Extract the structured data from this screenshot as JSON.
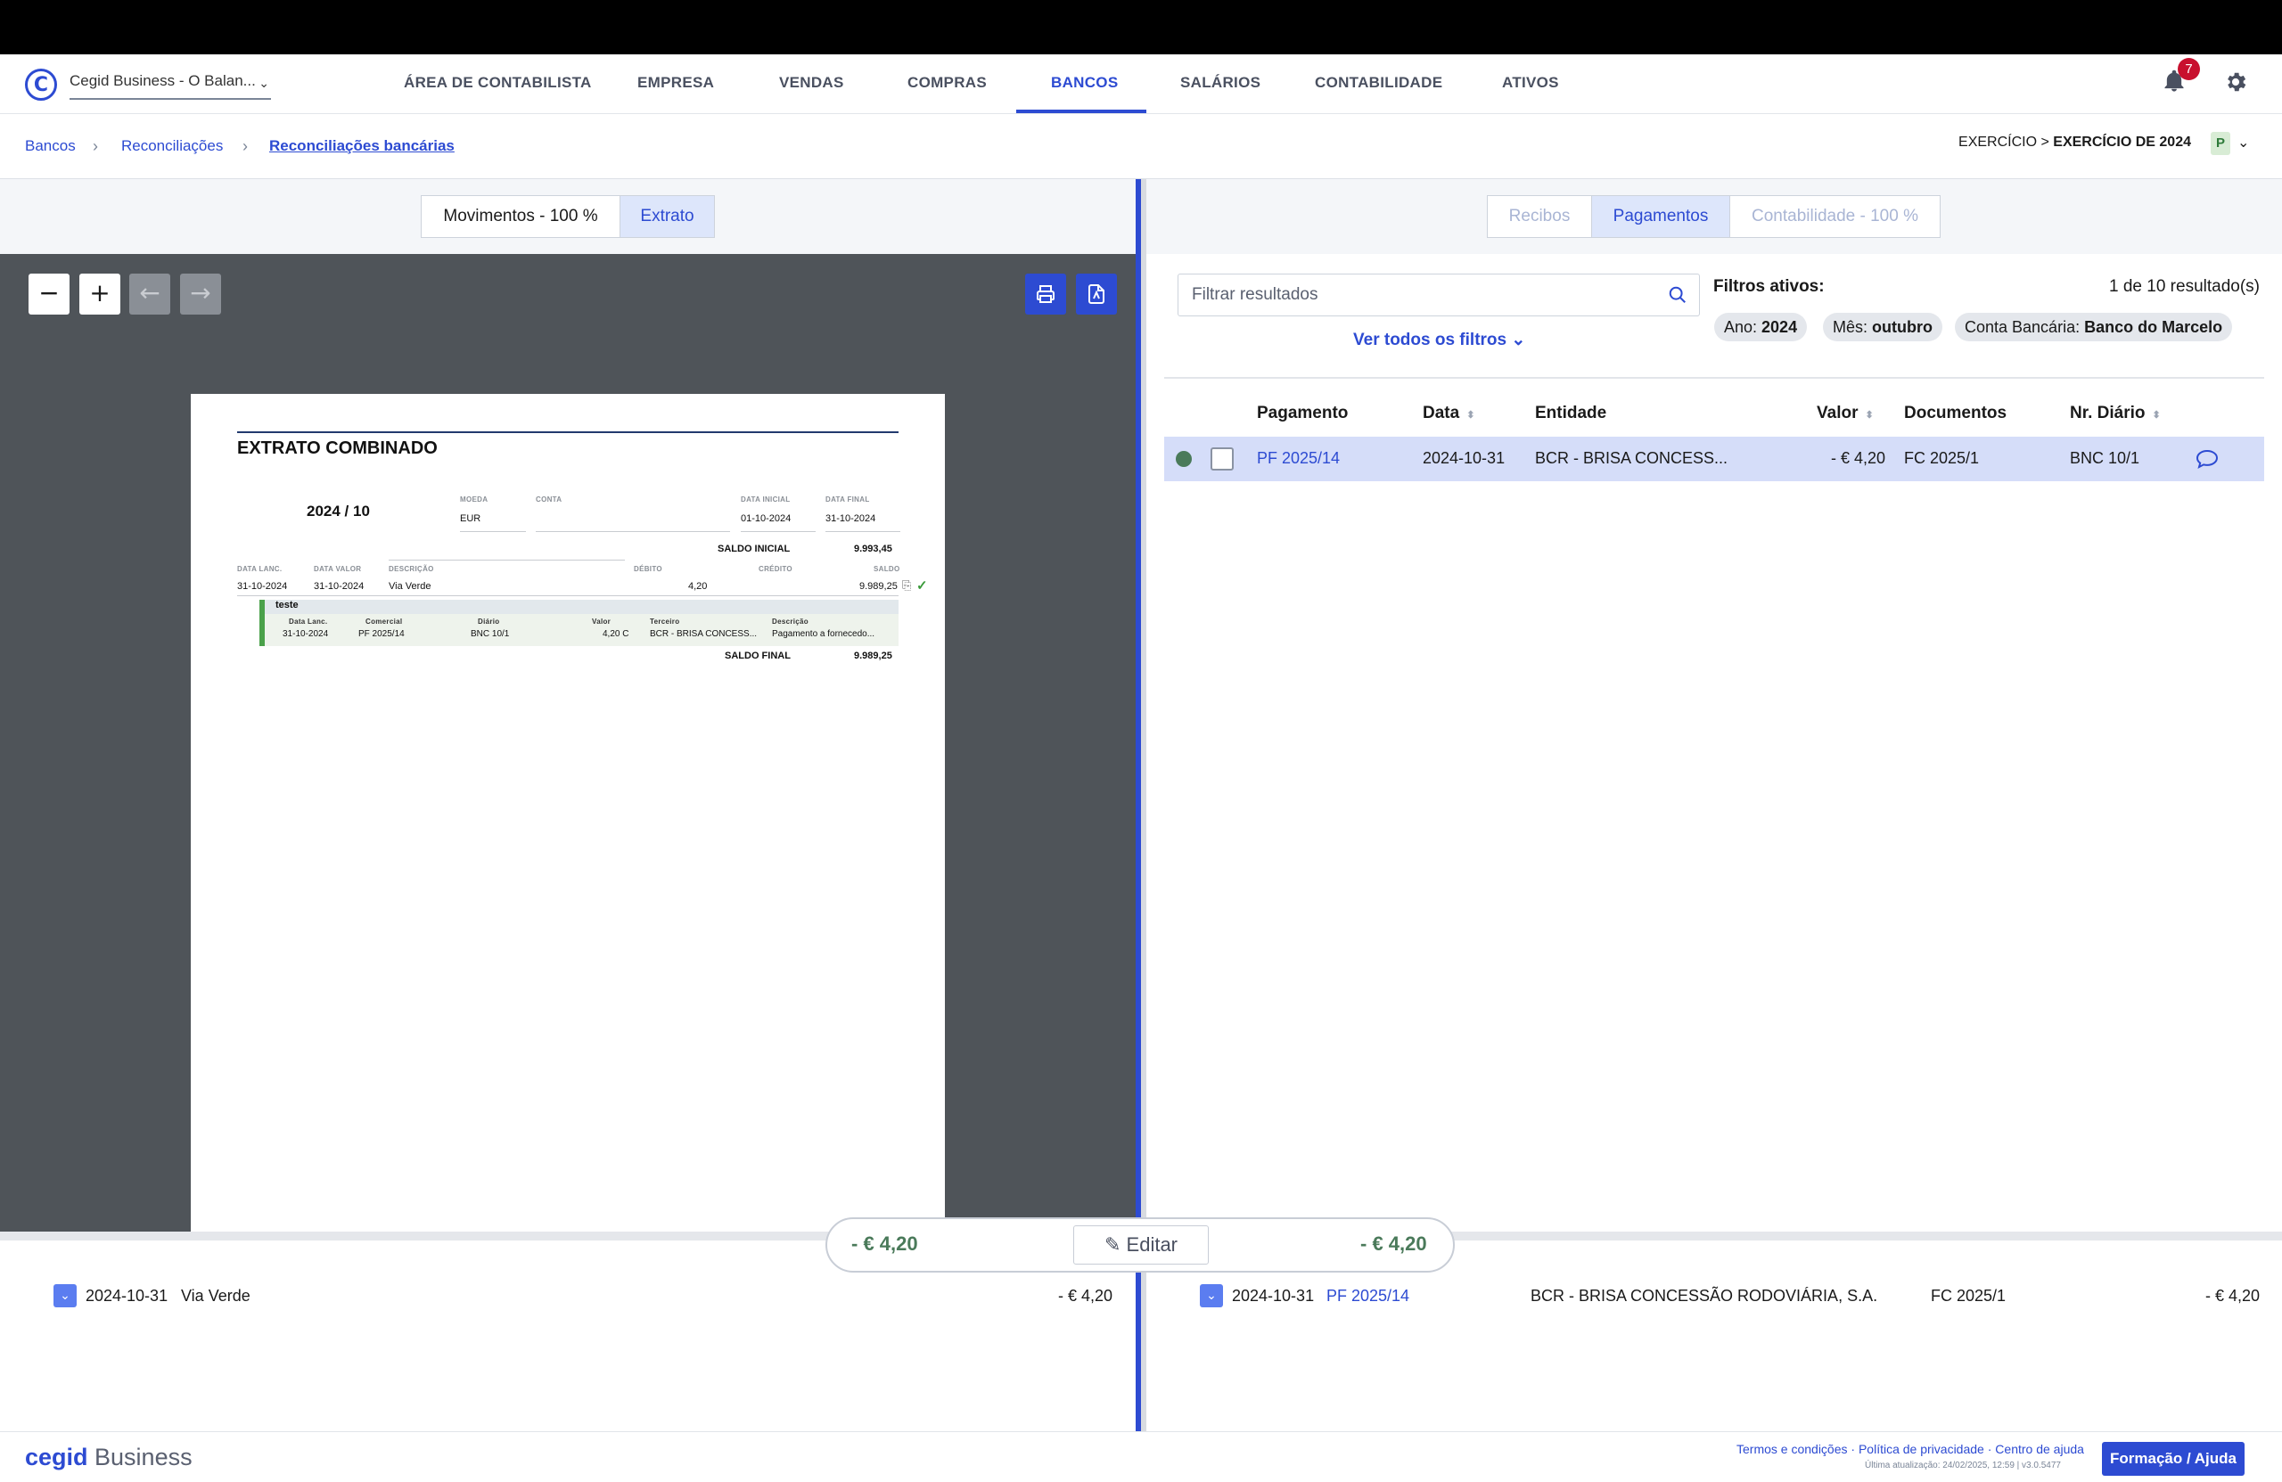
{
  "nav": {
    "company": "Cegid Business - O Balan...",
    "items": [
      "ÁREA DE CONTABILISTA",
      "EMPRESA",
      "VENDAS",
      "COMPRAS",
      "BANCOS",
      "SALÁRIOS",
      "CONTABILIDADE",
      "ATIVOS"
    ],
    "active": "BANCOS",
    "notifications": "7"
  },
  "breadcrumb": {
    "items": [
      "Bancos",
      "Reconciliações",
      "Reconciliações bancárias"
    ]
  },
  "exercise": {
    "label": "EXERCÍCIO > ",
    "value": "EXERCÍCIO DE 2024",
    "status": "P"
  },
  "left_tabs": {
    "movements": "Movimentos - 100 %",
    "statement": "Extrato"
  },
  "right_tabs": {
    "receipts": "Recibos",
    "payments": "Pagamentos",
    "accounting": "Contabilidade - 100 %"
  },
  "statement": {
    "title": "EXTRATO COMBINADO",
    "period": "2024 / 10",
    "labels": {
      "moeda": "MOEDA",
      "conta": "CONTA",
      "data_inicial": "DATA INICIAL",
      "data_final": "DATA FINAL",
      "data_lanc": "DATA LANC.",
      "data_valor": "DATA VALOR",
      "descricao": "DESCRIÇÃO",
      "debito": "DÉBITO",
      "credito": "CRÉDITO",
      "saldo": "SALDO"
    },
    "moeda": "EUR",
    "data_inicial": "01-10-2024",
    "data_final": "31-10-2024",
    "saldo_inicial_label": "SALDO INICIAL",
    "saldo_inicial": "9.993,45",
    "line": {
      "data_lanc": "31-10-2024",
      "data_valor": "31-10-2024",
      "descricao": "Via Verde",
      "debito": "4,20",
      "saldo": "9.989,25"
    },
    "group": {
      "title": "teste",
      "headers": [
        "Data Lanc.",
        "Comercial",
        "Diário",
        "Valor",
        "Terceiro",
        "Descrição"
      ],
      "row": [
        "31-10-2024",
        "PF 2025/14",
        "BNC 10/1",
        "4,20 C",
        "BCR - BRISA CONCESS...",
        "Pagamento a fornecedo..."
      ]
    },
    "saldo_final_label": "SALDO FINAL",
    "saldo_final": "9.989,25"
  },
  "filters": {
    "placeholder": "Filtrar resultados",
    "active_label": "Filtros ativos:",
    "results": "1 de 10 resultado(s)",
    "see_all": "Ver todos os filtros",
    "chips": [
      {
        "key": "Ano: ",
        "value": "2024"
      },
      {
        "key": "Mês: ",
        "value": "outubro"
      },
      {
        "key": "Conta Bancária: ",
        "value": "Banco do Marcelo"
      }
    ]
  },
  "table": {
    "headers": {
      "payment": "Pagamento",
      "date": "Data",
      "entity": "Entidade",
      "value": "Valor",
      "documents": "Documentos",
      "journal": "Nr. Diário"
    },
    "rows": [
      {
        "payment": "PF 2025/14",
        "date": "2024-10-31",
        "entity": "BCR - BRISA CONCESS...",
        "value": "- € 4,20",
        "documents": "FC 2025/1",
        "journal": "BNC 10/1"
      }
    ]
  },
  "summary": {
    "left": "- € 4,20",
    "edit": "Editar",
    "right": "- € 4,20"
  },
  "bottom_left": {
    "date": "2024-10-31",
    "description": "Via Verde",
    "value": "- € 4,20"
  },
  "bottom_right": {
    "date": "2024-10-31",
    "payment": "PF 2025/14",
    "entity": "BCR - BRISA CONCESSÃO RODOVIÁRIA, S.A.",
    "document": "FC 2025/1",
    "value": "- € 4,20"
  },
  "footer": {
    "brand_bold": "cegid",
    "brand": " Business",
    "links": [
      "Termos e condições",
      "Política de privacidade",
      "Centro de ajuda"
    ],
    "updated": "Última atualização: 24/02/2025, 12:59 | v3.0.5477",
    "help_button": "Formação / Ajuda"
  },
  "colors": {
    "accent": "#2d4bd2",
    "selected_row": "#d5ddf9",
    "positive": "#4a7a5a"
  }
}
